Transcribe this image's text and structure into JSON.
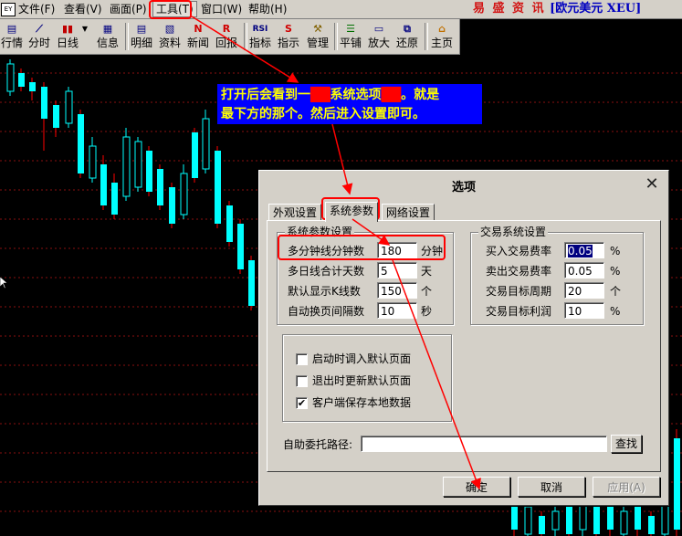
{
  "app": {
    "menu": [
      "文件(F)",
      "查看(V)",
      "画面(P)",
      "工具(T)",
      "窗口(W)",
      "帮助(H)"
    ],
    "brand_name": "易 盛 资 讯",
    "brand_sub": "[欧元美元 XEU]"
  },
  "toolbar": [
    {
      "icon": "list-icon",
      "label": "行情"
    },
    {
      "icon": "line-icon",
      "label": "分时"
    },
    {
      "icon": "candle-icon",
      "label": "日线"
    },
    {
      "icon": "info-icon",
      "label": "信息"
    },
    {
      "icon": "detail-icon",
      "label": "明细"
    },
    {
      "icon": "document-icon",
      "label": "资料"
    },
    {
      "icon": "news-icon",
      "label": "新闻",
      "glyph": "N"
    },
    {
      "icon": "review-icon",
      "label": "回报",
      "glyph": "R"
    },
    {
      "icon": "indicator-icon",
      "label": "指标",
      "glyph": "RSI"
    },
    {
      "icon": "signal-icon",
      "label": "指示",
      "glyph": "S"
    },
    {
      "icon": "tools-icon",
      "label": "管理"
    },
    {
      "icon": "tile-icon",
      "label": "平铺"
    },
    {
      "icon": "maximize-icon",
      "label": "放大"
    },
    {
      "icon": "restore-icon",
      "label": "还原"
    },
    {
      "icon": "home-icon",
      "label": "主页"
    }
  ],
  "annotation": {
    "line1_a": "打开后会看到一",
    "line1_b": "系统选项",
    "line1_c": "。就是",
    "line2": "最下方的那个。然后进入设置即可。"
  },
  "dialog": {
    "title": "选项",
    "tabs": [
      "外观设置",
      "系统参数",
      "网络设置"
    ],
    "active_tab": "系统参数",
    "system_group": {
      "title": "系统参数设置",
      "rows": [
        {
          "label": "多分钟线分钟数",
          "value": "180",
          "unit": "分钟"
        },
        {
          "label": "多日线合计天数",
          "value": "5",
          "unit": "天"
        },
        {
          "label": "默认显示K线数",
          "value": "150",
          "unit": "个"
        },
        {
          "label": "自动换页间隔数",
          "value": "10",
          "unit": "秒"
        }
      ]
    },
    "trade_group": {
      "title": "交易系统设置",
      "rows": [
        {
          "label": "买入交易费率",
          "value": "0.05",
          "unit": "%"
        },
        {
          "label": "卖出交易费率",
          "value": "0.05",
          "unit": "%"
        },
        {
          "label": "交易目标周期",
          "value": "20",
          "unit": "个"
        },
        {
          "label": "交易目标利润",
          "value": "10",
          "unit": "%"
        }
      ]
    },
    "checkboxes": [
      {
        "label": "启动时调入默认页面",
        "checked": false
      },
      {
        "label": "退出时更新默认页面",
        "checked": false
      },
      {
        "label": "客户端保存本地数据",
        "checked": true
      }
    ],
    "path_label": "自助委托路径:",
    "path_value": "",
    "browse_label": "查找",
    "ok_label": "确定",
    "cancel_label": "取消",
    "apply_label": "应用(A)"
  },
  "colors": {
    "up": "#00ffff",
    "down": "#ff0000",
    "annotation_bg": "#0000ff",
    "annotation_text": "#ffff00",
    "highlight": "#ff0000"
  }
}
